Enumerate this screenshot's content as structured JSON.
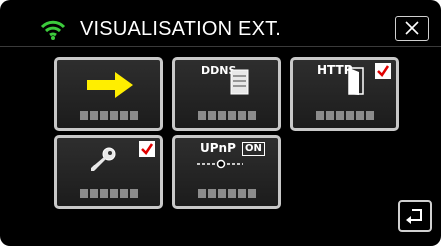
{
  "header": {
    "title": "VISUALISATION EXT.",
    "wifi_icon": "wifi-icon",
    "close_icon": "close-icon"
  },
  "tiles": [
    {
      "id": "start",
      "icon": "arrow-right-icon",
      "checked": false
    },
    {
      "id": "ddns",
      "icon": "server-icon",
      "text": "DDNS",
      "checked": false
    },
    {
      "id": "http",
      "icon": "door-icon",
      "text": "HTTP",
      "checked": true
    },
    {
      "id": "password",
      "icon": "key-icon",
      "checked": true
    },
    {
      "id": "upnp",
      "icon": "upnp-slider-icon",
      "text": "UPnP",
      "badge": "ON",
      "checked": false
    }
  ],
  "footer": {
    "back_icon": "return-icon"
  },
  "colors": {
    "accent_arrow": "#ffee00",
    "wifi": "#3ccb3c",
    "check": "#e00000",
    "tile_border": "#c8c8c8"
  }
}
